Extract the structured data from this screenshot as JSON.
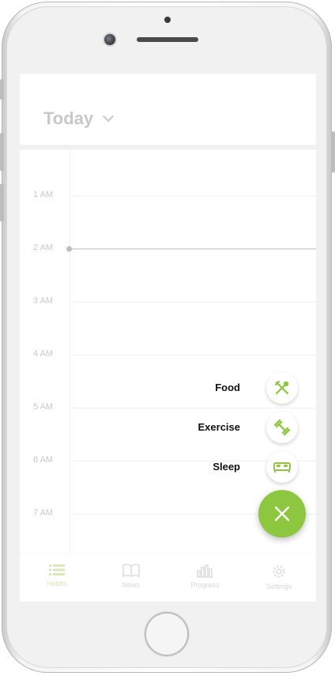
{
  "header": {
    "title": "Today"
  },
  "timeline": {
    "hours": [
      "1 AM",
      "2 AM",
      "3 AM",
      "4 AM",
      "5 AM",
      "6 AM",
      "7 AM"
    ]
  },
  "fab_menu": {
    "items": [
      {
        "label": "Food",
        "icon": "fork-spoon-icon"
      },
      {
        "label": "Exercise",
        "icon": "dumbbell-icon"
      },
      {
        "label": "Sleep",
        "icon": "bed-icon"
      }
    ],
    "main_icon": "close-icon"
  },
  "tabbar": {
    "items": [
      {
        "label": "Habits",
        "icon": "list-icon",
        "active": true
      },
      {
        "label": "News",
        "icon": "book-icon",
        "active": false
      },
      {
        "label": "Progress",
        "icon": "bar-chart-icon",
        "active": false
      },
      {
        "label": "Settings",
        "icon": "gear-icon",
        "active": false
      }
    ]
  },
  "colors": {
    "accent": "#8dc63f",
    "muted_text": "#c8c8c8",
    "background": "#f8f8f8"
  }
}
